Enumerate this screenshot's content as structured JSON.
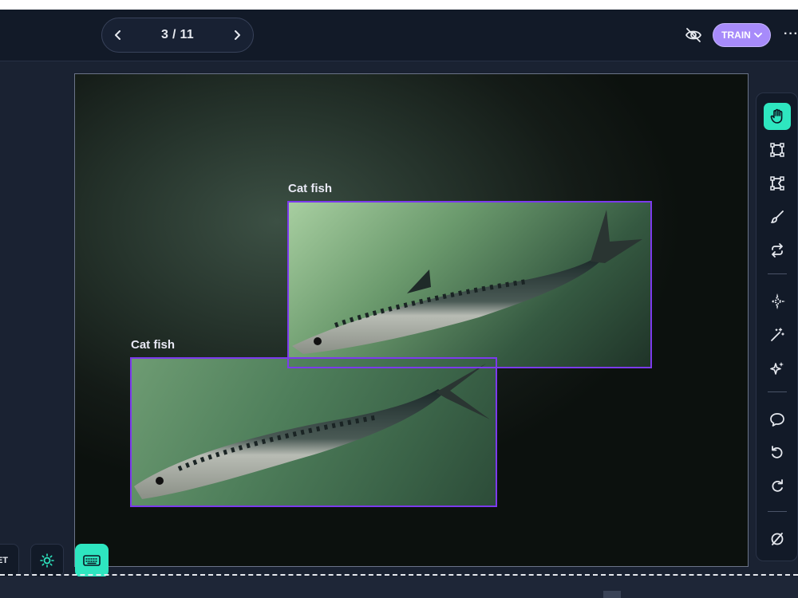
{
  "header": {
    "pager": {
      "text": "3 / 11"
    },
    "train_label": "TRAIN",
    "more_label": "···"
  },
  "annotations": [
    {
      "label": "Cat fish"
    },
    {
      "label": "Cat fish"
    }
  ],
  "bottom_left": {
    "reset_label": "ET"
  },
  "icons": {
    "prev": "chevron-left-icon",
    "next": "chevron-right-icon",
    "visibility": "eye-off-icon",
    "pan": "hand-icon",
    "bbox": "rectangle-icon",
    "polygon": "polygon-icon",
    "brush": "brush-icon",
    "repeat": "repeat-icon",
    "smart": "magic-sparkle-icon",
    "wand": "magic-wand-icon",
    "sparkles": "sparkles-icon",
    "comment": "comment-icon",
    "undo": "undo-icon",
    "redo": "redo-icon",
    "clear": "empty-set-icon",
    "brightness": "sun-icon",
    "keyboard": "keyboard-icon"
  },
  "colors": {
    "accent": "#2ee6c0",
    "train": "#a78bfa",
    "bbox": "#7c3aed"
  }
}
